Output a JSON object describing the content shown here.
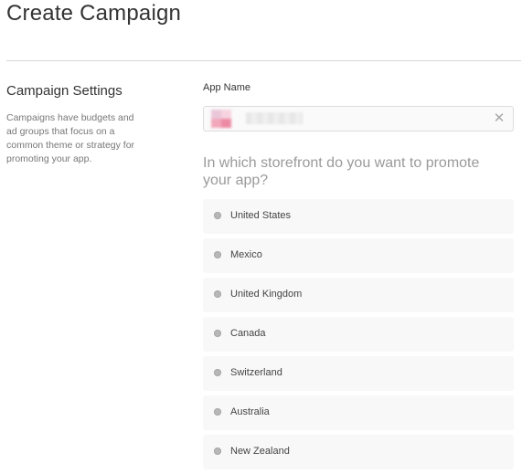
{
  "page": {
    "title": "Create Campaign"
  },
  "settings": {
    "heading": "Campaign Settings",
    "description": "Campaigns have budgets and ad groups that focus on a common theme or strategy for promoting your app."
  },
  "app_field": {
    "label": "App Name",
    "icons": {
      "app": "app-icon",
      "clear": "close-icon"
    }
  },
  "storefront": {
    "question": "In which storefront do you want to promote your app?",
    "options": [
      {
        "label": "United States"
      },
      {
        "label": "Mexico"
      },
      {
        "label": "United Kingdom"
      },
      {
        "label": "Canada"
      },
      {
        "label": "Switzerland"
      },
      {
        "label": "Australia"
      },
      {
        "label": "New Zealand"
      }
    ]
  },
  "colors": {
    "heading_text": "#333333",
    "muted_text": "#777777",
    "question_text": "#9a9a9a",
    "option_bg": "#f8f8f8",
    "radio": "#b7b7b7"
  }
}
